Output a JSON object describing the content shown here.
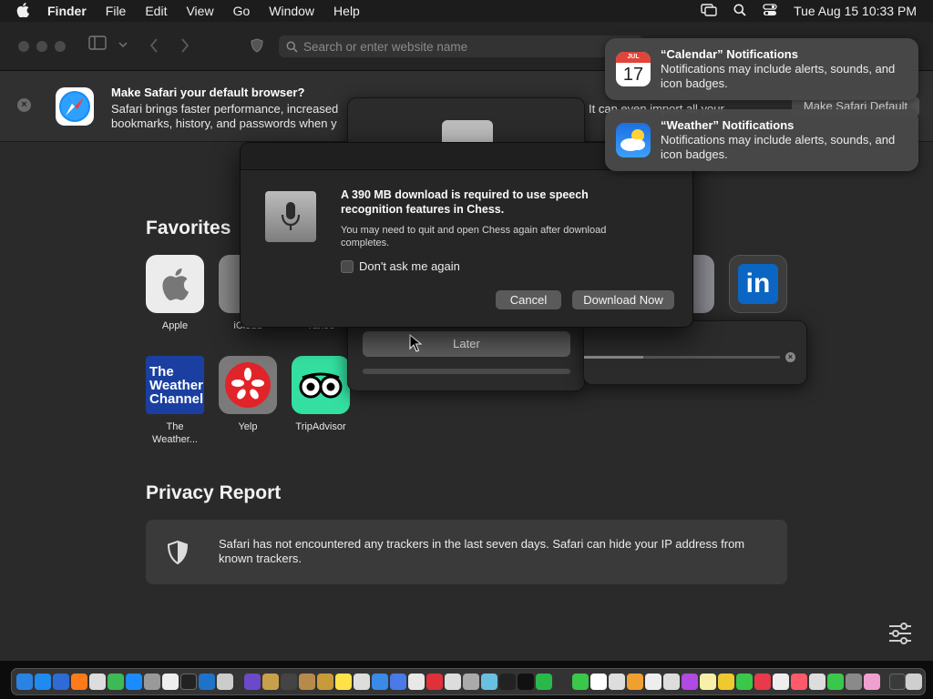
{
  "menubar": {
    "app": "Finder",
    "items": [
      "File",
      "Edit",
      "View",
      "Go",
      "Window",
      "Help"
    ],
    "clock": "Tue Aug 15  10:33 PM"
  },
  "safari": {
    "address_placeholder": "Search or enter website name",
    "banner": {
      "title": "Make Safari your default browser?",
      "body_line1": "Safari brings faster performance, increased",
      "body_line2": "bookmarks, history, and passwords when y",
      "right_text": "It can even import all your",
      "button": "Make Safari Default"
    },
    "favorites_title": "Favorites",
    "favorites": [
      {
        "label": "Apple"
      },
      {
        "label": "iCloud"
      },
      {
        "label": "Yahoo"
      },
      {
        "label": "The Weather..."
      },
      {
        "label": "Yelp"
      },
      {
        "label": "TripAdvisor"
      }
    ],
    "weather_tile_text": [
      "The",
      "Weather",
      "Channel"
    ],
    "linkedin_text": "in",
    "privacy_title": "Privacy Report",
    "privacy_text": "Safari has not encountered any trackers in the last seven days. Safari can hide your IP address from known trackers."
  },
  "underlying_sheet": {
    "later_button": "Later"
  },
  "dialog": {
    "message": "A 390 MB download is required to use speech recognition features in Chess.",
    "info": "You may need to quit and open Chess again after download completes.",
    "checkbox_label": "Don't ask me again",
    "checkbox_checked": false,
    "cancel_label": "Cancel",
    "download_label": "Download Now"
  },
  "notifications": [
    {
      "title": "“Calendar” Notifications",
      "body": "Notifications may include alerts, sounds, and icon badges.",
      "icon": "calendar-icon",
      "month": "JUL",
      "day": "17"
    },
    {
      "title": "“Weather” Notifications",
      "body": "Notifications may include alerts, sounds, and icon badges.",
      "icon": "weather-icon"
    }
  ],
  "colors": {
    "linkedin": "#0a66c2",
    "weather_channel": "#1b3fa0",
    "yelp": "#e0242a",
    "tripadvisor": "#34e0a1"
  }
}
